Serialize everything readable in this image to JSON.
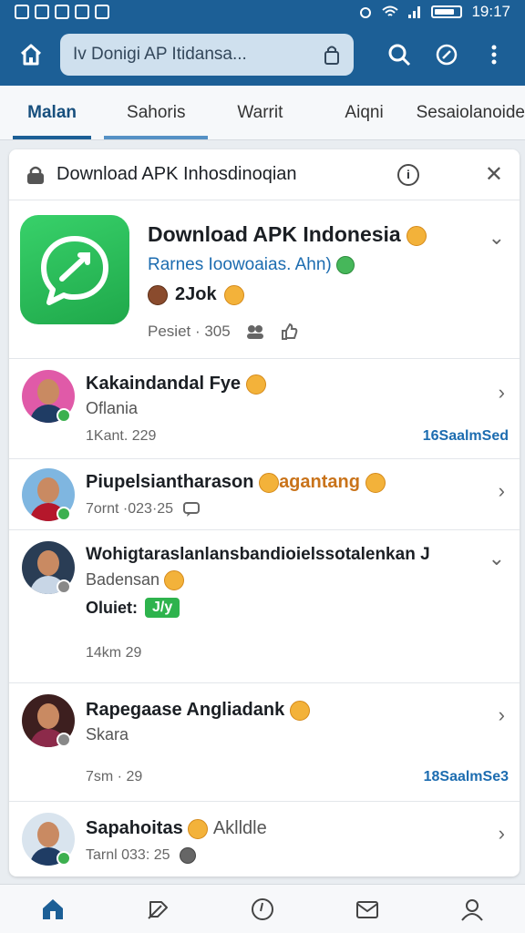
{
  "status_bar": {
    "time": "19:17"
  },
  "header": {
    "search_placeholder": "Iv Donigi AP Itidansa...",
    "home_icon": "home-icon",
    "accent_color": "#1c5f96"
  },
  "tabs": [
    "Malan",
    "Sahoris",
    "Warrit",
    "Aiqni",
    "Sesaiolanoide"
  ],
  "card": {
    "header_title": "Download APK Inhosdinoqian",
    "featured": {
      "title": "Download APK Indonesia",
      "subtitle": "Rarnes Ioowoaias. Ahn)",
      "count": "2Jok",
      "meta": "Pesiet · 305"
    }
  },
  "items": [
    {
      "name": "Kakaindandal Fye",
      "sub": "Oflania",
      "meta": "1Kant.  229",
      "tag": "16SaalmSed"
    },
    {
      "name": "Piupelsiantharason",
      "name_extra": "agantang",
      "sub": "",
      "meta": "7ornt ·023·25",
      "tag": ""
    },
    {
      "name": "Wohigtaraslanlansbandioielssotalenkan J",
      "sub": "Badensan",
      "status_label": "Oluiet:",
      "status_badge": "J/y",
      "meta": "14km   29",
      "tag": ""
    },
    {
      "name": "Rapegaase Angliadank",
      "sub": "Skara",
      "meta": "7sm ·  29",
      "tag": "18SaalmSe3"
    },
    {
      "name": "Sapahoitas",
      "name_extra": "Aklldle",
      "sub": "",
      "meta": "Tarnl  033:  25",
      "tag": ""
    }
  ],
  "bottom_nav": [
    "home-icon",
    "feather-icon",
    "clock-icon",
    "mail-icon",
    "profile-icon"
  ]
}
